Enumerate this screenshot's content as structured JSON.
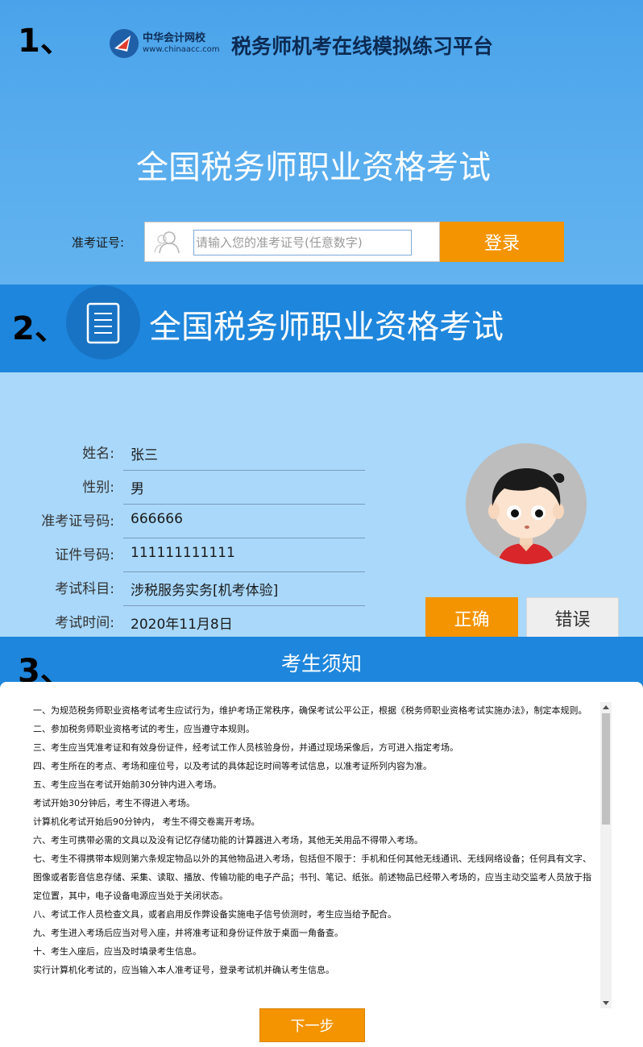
{
  "section1": {
    "step": "1、",
    "logo": {
      "cn": "中华会计网校",
      "en": "www.chinaacc.com"
    },
    "platform_title": "税务师机考在线模拟练习平台",
    "main_title": "全国税务师职业资格考试",
    "login_label": "准考证号:",
    "input_placeholder": "请输入您的准考证号(任意数字)",
    "login_button": "登录"
  },
  "section2": {
    "step": "2、",
    "title": "全国税务师职业资格考试",
    "fields": [
      {
        "label": "姓名:",
        "value": "张三"
      },
      {
        "label": "性别:",
        "value": "男"
      },
      {
        "label": "准考证号码:",
        "value": "666666"
      },
      {
        "label": "证件号码:",
        "value": "111111111111"
      },
      {
        "label": "考试科目:",
        "value": "涉税服务实务[机考体验]"
      },
      {
        "label": "考试时间:",
        "value": "2020年11月8日"
      }
    ],
    "correct_button": "正确",
    "wrong_button": "错误"
  },
  "section3": {
    "step": "3、",
    "title": "考生须知",
    "rules": [
      "一、为规范税务师职业资格考试考生应试行为，维护考场正常秩序，确保考试公平公正，根据《税务师职业资格考试实施办法》，制定本规则。",
      "二、参加税务师职业资格考试的考生，应当遵守本规则。",
      "三、考生应当凭准考证和有效身份证件，经考试工作人员核验身份，并通过现场采像后，方可进入指定考场。",
      "四、考生所在的考点、考场和座位号，以及考试的具体起讫时间等考试信息，以准考证所列内容为准。",
      "五、考生应当在考试开始前30分钟内进入考场。",
      "考试开始30分钟后，考生不得进入考场。",
      "计算机化考试开始后90分钟内， 考生不得交卷离开考场。",
      "六、考生可携带必需的文具以及没有记忆存储功能的计算器进入考场，其他无关用品不得带入考场。",
      "七、考生不得携带本规则第六条规定物品以外的其他物品进入考场，包括但不限于：手机和任何其他无线通讯、无线网络设备；任何具有文字、图像或者影音信息存储、采集、读取、播放、传输功能的电子产品；书刊、笔记、纸张。前述物品已经带入考场的，应当主动交监考人员放于指定位置，其中，电子设备电源应当处于关闭状态。",
      "八、考试工作人员检查文具，或者启用反作弊设备实施电子信号侦测时，考生应当给予配合。",
      "九、考生进入考场后应当对号入座，并将准考证和身份证件放于桌面一角备查。",
      "十、考生入座后，应当及时填录考生信息。",
      "实行计算机化考试的，应当输入本人准考证号，登录考试机并确认考生信息。"
    ],
    "next_button": "下一步"
  },
  "colors": {
    "accent_orange": "#f39400",
    "header_blue": "#1e86dc",
    "info_bg": "#a9d8fb"
  }
}
